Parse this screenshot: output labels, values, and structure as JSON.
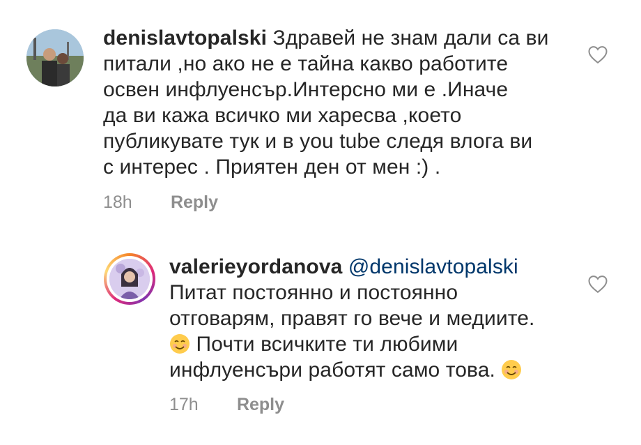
{
  "comments": [
    {
      "username": "denislavtopalski",
      "lines": [
        "Здравей не знам дали са ви",
        "питали ,но ако не е тайна какво работите",
        "освен инфлуенсър.Интерсно ми е .Иначе",
        "да ви кажа всичко ми харесва ,което",
        "публикувате тук и в you tube следя влога ви",
        "с интерес . Приятен ден от мен :) ."
      ],
      "time": "18h",
      "reply_label": "Reply"
    },
    {
      "username": "valerieyordanova",
      "mention": "@denislavtopalski",
      "lines": [
        "Питат постоянно и постоянно",
        "отговарям, правят го вече и медиите.",
        "Почти всичките ти любими",
        "инфлуенсъри работят само това."
      ],
      "time": "17h",
      "reply_label": "Reply"
    }
  ],
  "icons": {
    "like": "heart-outline-icon",
    "emoji": "smiling-face-icon"
  },
  "colors": {
    "text": "#262626",
    "muted": "#8e8e8e",
    "mention": "#00376b"
  }
}
